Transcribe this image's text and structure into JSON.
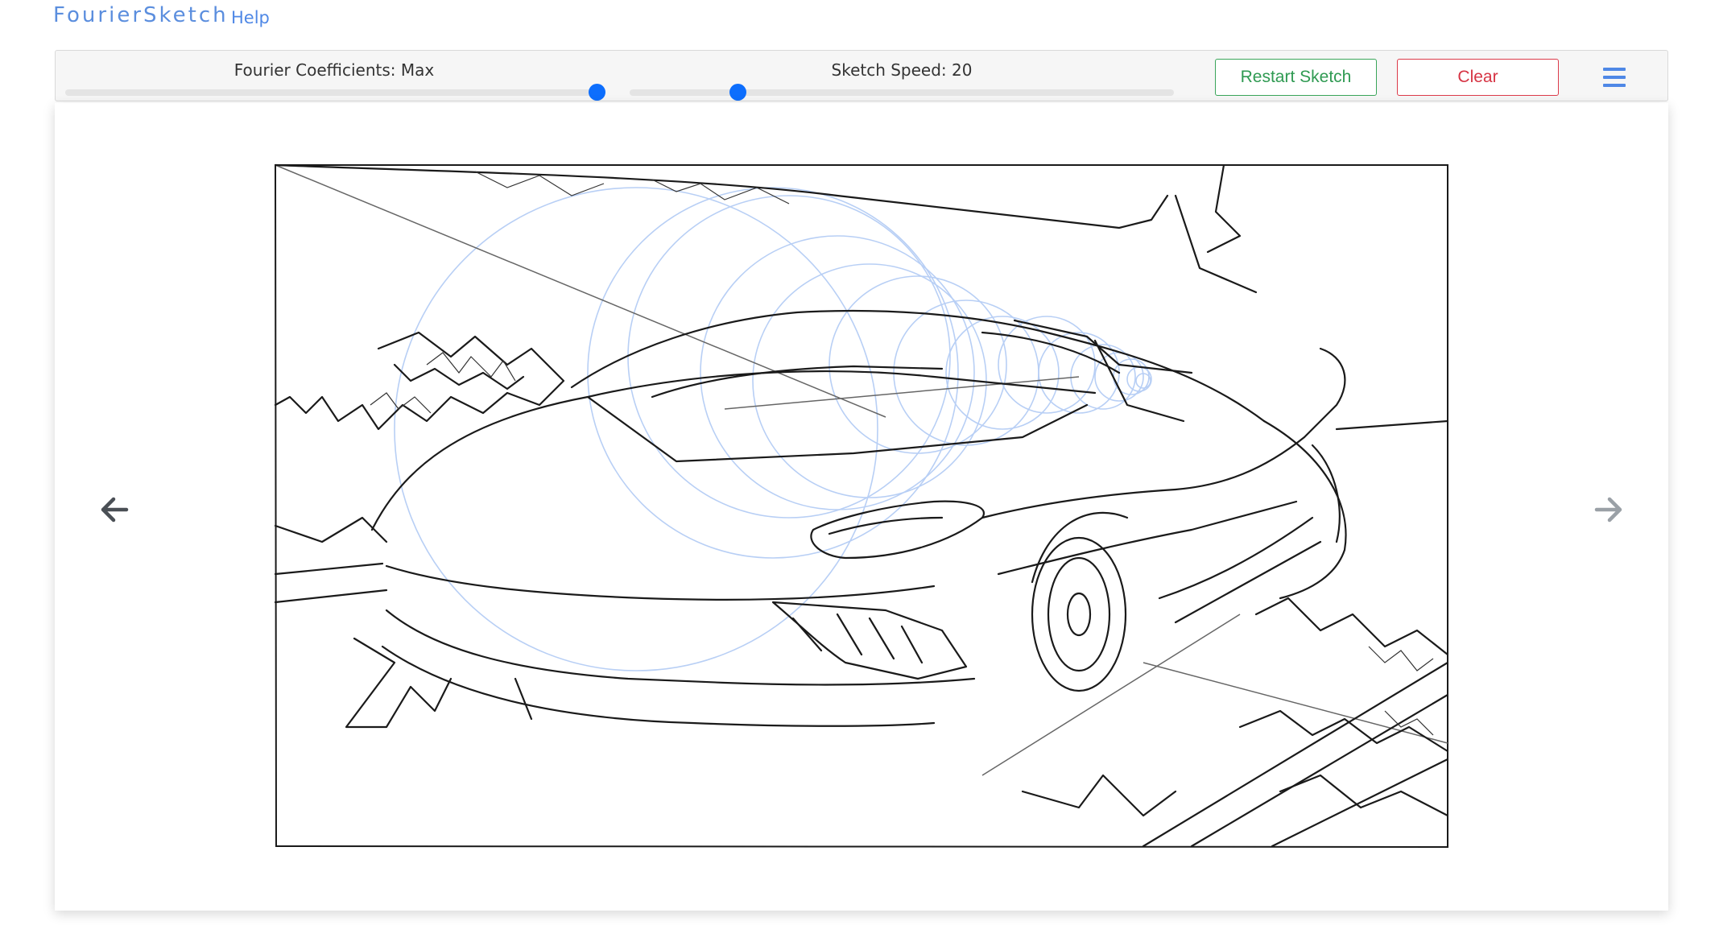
{
  "nav": {
    "brand": "FourierSketch",
    "help": "Help"
  },
  "toolbar": {
    "coefficients": {
      "label": "Fourier Coefficients: Max",
      "value_fraction": 0.99
    },
    "speed": {
      "label": "Sketch Speed: 20",
      "value_fraction": 0.2
    },
    "restart_label": "Restart Sketch",
    "clear_label": "Clear",
    "menu_icon": "hamburger-menu-icon"
  },
  "canvas": {
    "content": "car-line-sketch",
    "prev_icon": "arrow-left-icon",
    "next_icon": "arrow-right-icon"
  },
  "colors": {
    "brand": "#5b8ede",
    "accent": "#0d6efd",
    "restart": "#2f9a52",
    "clear": "#d63444",
    "epicycle": "#b8cff5",
    "stroke": "#1a1a1a"
  }
}
